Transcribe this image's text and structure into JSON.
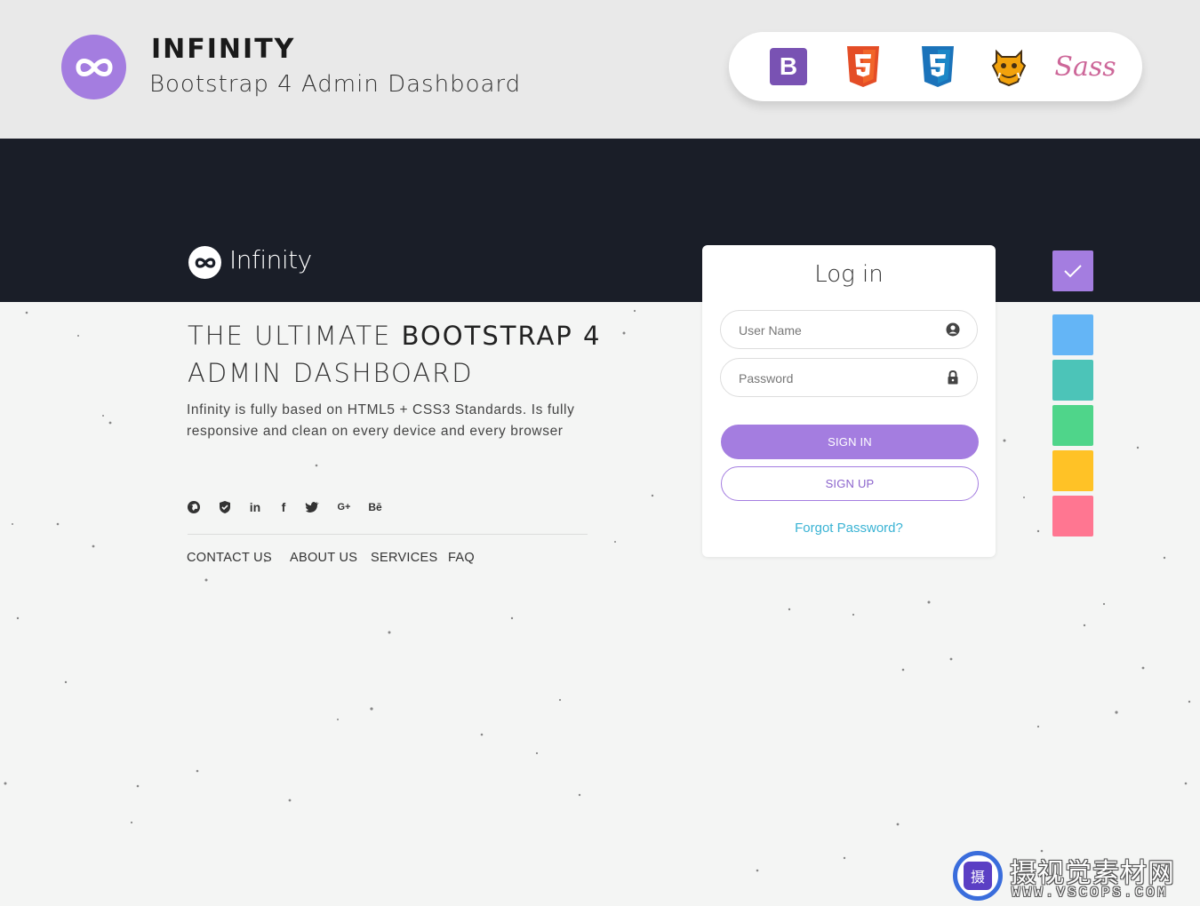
{
  "banner": {
    "title": "INFINITY",
    "subtitle": "Bootstrap 4 Admin Dashboard",
    "tech_icons": [
      {
        "icon": "bootstrap-icon",
        "glyph": "B",
        "color": "#7952b3"
      },
      {
        "icon": "html5-icon",
        "glyph": "5",
        "color": "#e44d26"
      },
      {
        "icon": "css3-icon",
        "glyph": "3",
        "color": "#1b9ad6"
      },
      {
        "icon": "grunt-icon",
        "color": "#f2a20c"
      },
      {
        "icon": "sass-icon",
        "glyph": "Sass",
        "color": "#cd6799"
      }
    ]
  },
  "hero": {
    "brand": "Infinity",
    "title_light": "THE ULTIMATE ",
    "title_bold": "BOOTSTRAP 4",
    "title_line2": "ADMIN DASHBOARD",
    "description": "Infinity is fully based on HTML5 + CSS3 Standards. Is fully responsive and clean on every device and every browser",
    "social": [
      {
        "icon": "globe-icon",
        "glyph": "◉"
      },
      {
        "icon": "shield-icon",
        "glyph": "⛨"
      },
      {
        "icon": "linkedin-icon",
        "glyph": "in"
      },
      {
        "icon": "facebook-icon",
        "glyph": "f"
      },
      {
        "icon": "twitter-icon",
        "glyph": "🐦"
      },
      {
        "icon": "google-plus-icon",
        "glyph": "G+"
      },
      {
        "icon": "behance-icon",
        "glyph": "Bē"
      }
    ],
    "footer_links": [
      "CONTACT US",
      "ABOUT US",
      "SERVICES",
      "FAQ"
    ]
  },
  "login": {
    "title": "Log in",
    "username_placeholder": "User Name",
    "password_placeholder": "Password",
    "sign_in": "SIGN IN",
    "sign_up": "SIGN UP",
    "forgot": "Forgot Password?"
  },
  "swatches": [
    {
      "color": "#a47de0",
      "selected": true
    },
    {
      "color": "#64b5f6",
      "selected": false
    },
    {
      "color": "#4cc4b8",
      "selected": false
    },
    {
      "color": "#4fd58a",
      "selected": false
    },
    {
      "color": "#ffc226",
      "selected": false
    },
    {
      "color": "#ff7691",
      "selected": false
    }
  ],
  "watermark": {
    "cn_text": "摄视觉素材网",
    "url": "WWW.VSCOPS.COM",
    "logo_glyph": "摄"
  }
}
